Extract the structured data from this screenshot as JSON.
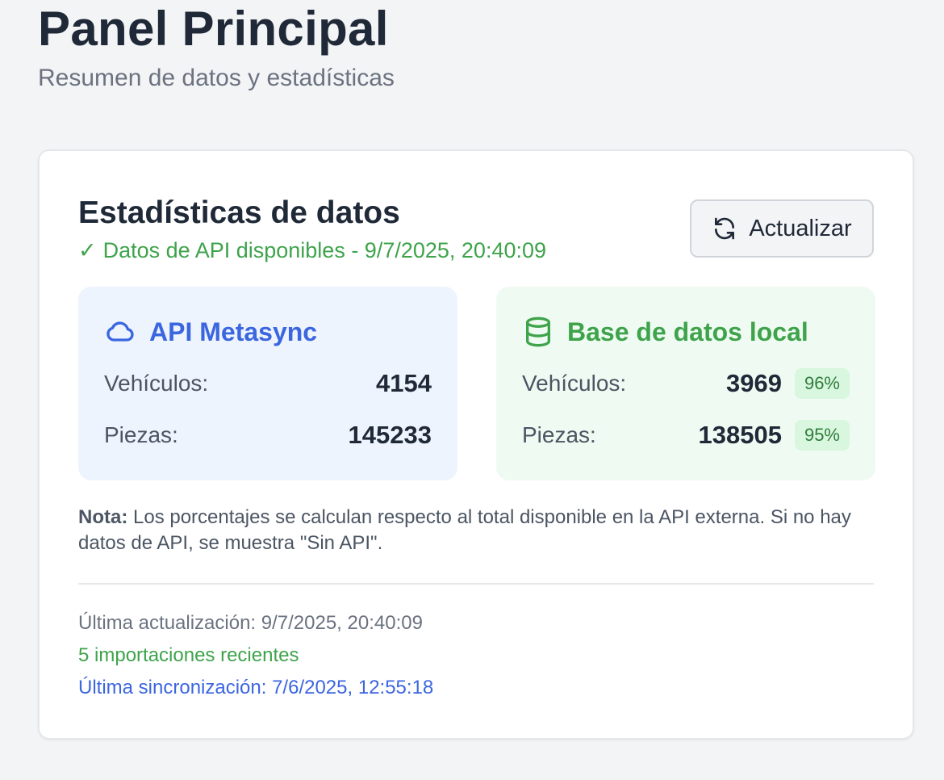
{
  "header": {
    "title": "Panel Principal",
    "subtitle": "Resumen de datos y estadísticas"
  },
  "stats_card": {
    "title": "Estadísticas de datos",
    "status_check": "✓",
    "status_text": "Datos de API disponibles - 9/7/2025, 20:40:09",
    "refresh_label": "Actualizar",
    "refresh_icon": "refresh-icon"
  },
  "api_panel": {
    "title": "API Metasync",
    "icon": "cloud-icon",
    "vehicles_label": "Vehículos:",
    "vehicles_value": "4154",
    "parts_label": "Piezas:",
    "parts_value": "145233"
  },
  "local_panel": {
    "title": "Base de datos local",
    "icon": "database-icon",
    "vehicles_label": "Vehículos:",
    "vehicles_value": "3969",
    "vehicles_pct": "96%",
    "parts_label": "Piezas:",
    "parts_value": "138505",
    "parts_pct": "95%"
  },
  "note": {
    "label": "Nota:",
    "text": " Los porcentajes se calculan respecto al total disponible en la API externa. Si no hay datos de API, se muestra \"Sin API\"."
  },
  "footer": {
    "last_update": "Última actualización: 9/7/2025, 20:40:09",
    "recent_imports": "5 importaciones recientes",
    "last_sync": "Última sincronización: 7/6/2025, 12:55:18"
  },
  "colors": {
    "accent_blue": "#3b66e0",
    "accent_green": "#3ea34b",
    "api_panel_bg": "#eef4fd",
    "local_panel_bg": "#effbf2",
    "pct_badge_bg": "#d9f6df"
  }
}
